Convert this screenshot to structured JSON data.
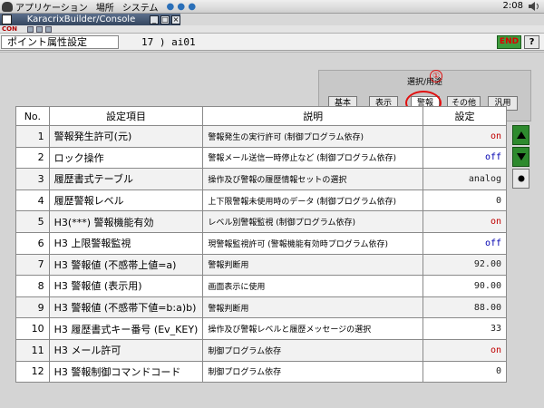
{
  "top_panel": {
    "menus": [
      "アプリケーション",
      "場所",
      "システム"
    ],
    "clock": "2:08"
  },
  "console_window": {
    "title": "KaracrixBuilder/Console",
    "minimize": "_",
    "maximize": "□",
    "close": "×",
    "tag": "CON"
  },
  "header": {
    "page_title": "ポイント属性設定",
    "point_id": "17 ) ai01",
    "end_label": "END",
    "help_label": "?"
  },
  "filter": {
    "label": "選択/用途",
    "marker": "①",
    "buttons": [
      {
        "label": "基本"
      },
      {
        "label": "表示"
      },
      {
        "label": "警報",
        "selected": true
      },
      {
        "label": "その他"
      },
      {
        "label": "汎用"
      }
    ]
  },
  "table": {
    "headers": [
      "No.",
      "設定項目",
      "説明",
      "設定"
    ],
    "rows": [
      {
        "no": "1",
        "item": "警報発生許可(元)",
        "desc": "警報発生の実行許可 (制御プログラム依存)",
        "value": "on",
        "color": "#c00000"
      },
      {
        "no": "2",
        "item": "ロック操作",
        "desc": "警報メール送信一時停止など (制御プログラム依存)",
        "value": "off",
        "color": "#0000b0"
      },
      {
        "no": "3",
        "item": "履歴書式テーブル",
        "desc": "操作及び警報の履歴情報セットの選択",
        "value": "analog",
        "color": "#222222"
      },
      {
        "no": "4",
        "item": "履歴警報レベル",
        "desc": "上下限警報未使用時のデータ (制御プログラム依存)",
        "value": "0",
        "color": "#222222"
      },
      {
        "no": "5",
        "item": "H3(***) 警報機能有効",
        "desc": "レベル別警報監視 (制御プログラム依存)",
        "value": "on",
        "color": "#c00000"
      },
      {
        "no": "6",
        "item": "H3 上限警報監視",
        "desc": "現警報監視許可 (警報機能有効時プログラム依存)",
        "value": "off",
        "color": "#0000b0"
      },
      {
        "no": "7",
        "item": "H3 警報値 (不感帯上値=a)",
        "desc": "警報判断用",
        "value": "92.00",
        "color": "#222222"
      },
      {
        "no": "8",
        "item": "H3 警報値 (表示用)",
        "desc": "画面表示に使用",
        "value": "90.00",
        "color": "#222222"
      },
      {
        "no": "9",
        "item": "H3 警報値 (不感帯下値=b:a)b)",
        "desc": "警報判断用",
        "value": "88.00",
        "color": "#222222"
      },
      {
        "no": "10",
        "item": "H3 履歴書式キー番号 (Ev_KEY)",
        "desc": "操作及び警報レベルと履歴メッセージの選択",
        "value": "33",
        "color": "#222222"
      },
      {
        "no": "11",
        "item": "H3 メール許可",
        "desc": "制御プログラム依存",
        "value": "on",
        "color": "#c00000"
      },
      {
        "no": "12",
        "item": "H3 警報制御コマンドコード",
        "desc": "制御プログラム依存",
        "value": "0",
        "color": "#222222"
      }
    ]
  },
  "scroll_buttons": [
    "up-arrow-icon",
    "down-arrow-icon",
    "dot-icon"
  ]
}
